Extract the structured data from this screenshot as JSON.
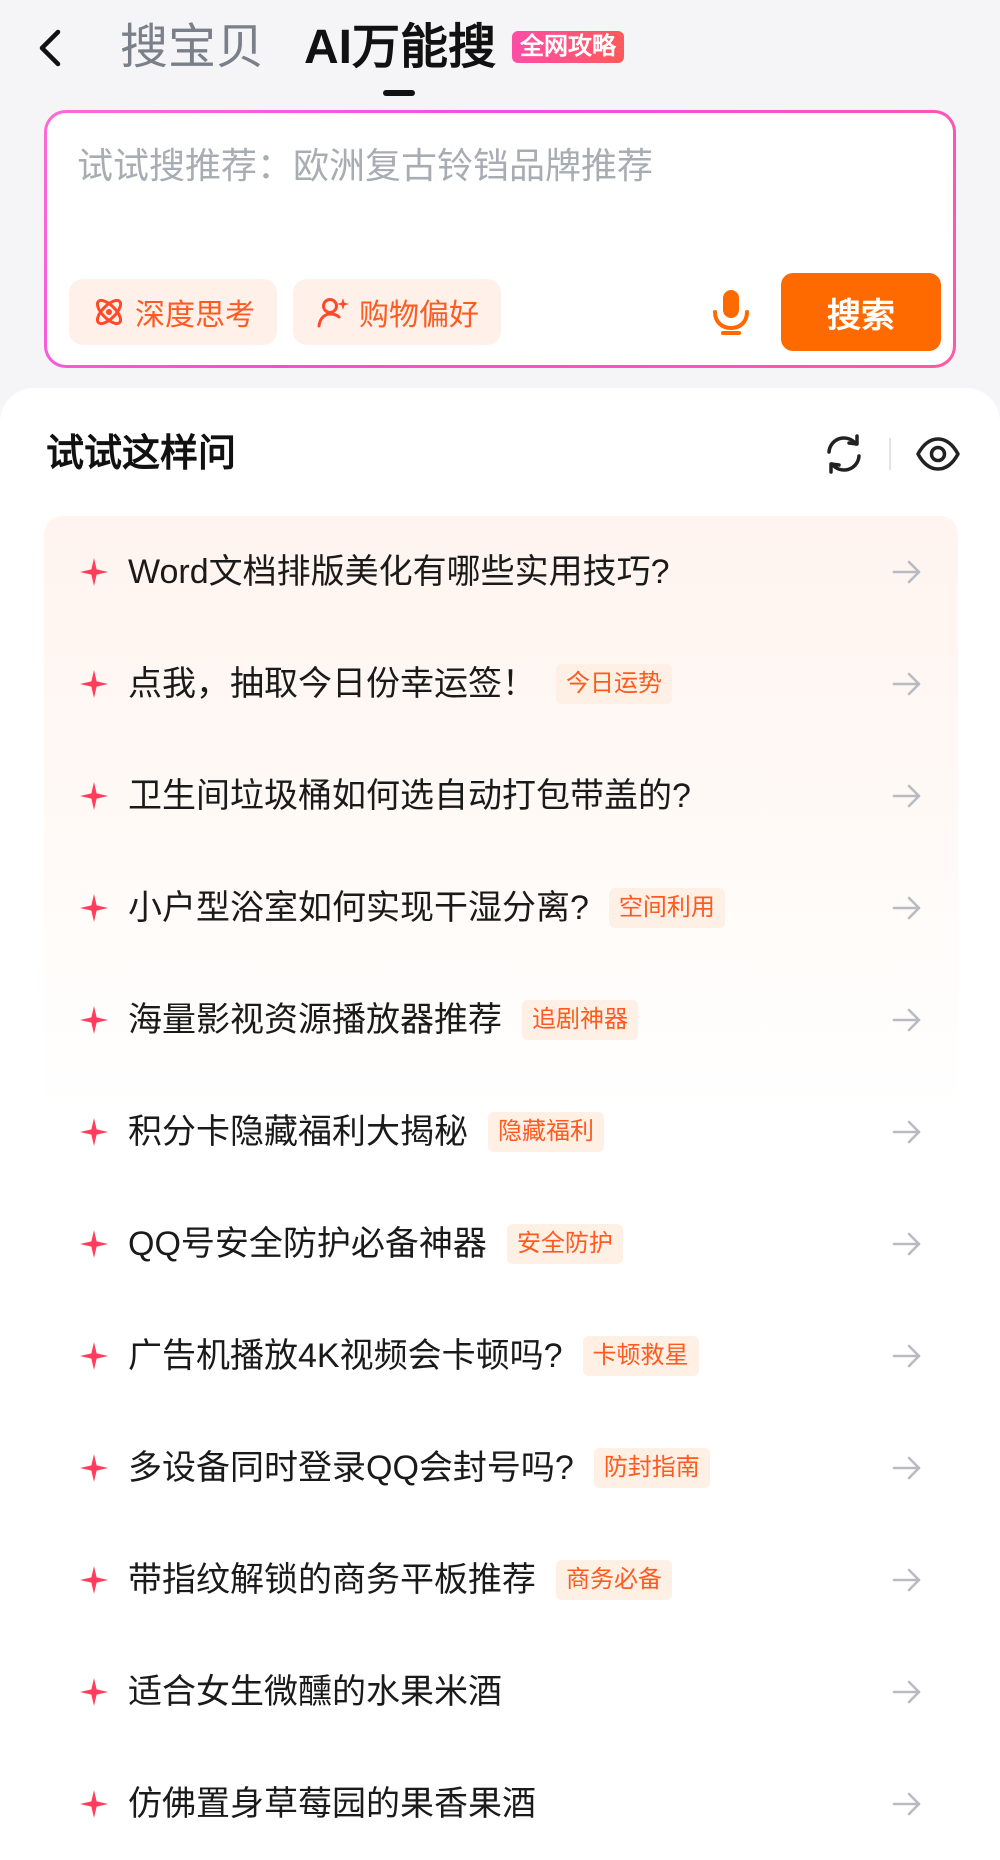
{
  "header": {
    "tab_goods": "搜宝贝",
    "tab_ai": "AI万能搜",
    "badge": "全网攻略"
  },
  "search": {
    "placeholder": "试试搜推荐：欧洲复古铃铛品牌推荐",
    "chip_deep": "深度思考",
    "chip_pref": "购物偏好",
    "button": "搜索"
  },
  "panel": {
    "title": "试试这样问",
    "items": [
      {
        "text": "Word文档排版美化有哪些实用技巧?",
        "tag": ""
      },
      {
        "text": "点我，抽取今日份幸运签！",
        "tag": "今日运势"
      },
      {
        "text": "卫生间垃圾桶如何选自动打包带盖的?",
        "tag": ""
      },
      {
        "text": "小户型浴室如何实现干湿分离?",
        "tag": "空间利用"
      },
      {
        "text": "海量影视资源播放器推荐",
        "tag": "追剧神器"
      },
      {
        "text": "积分卡隐藏福利大揭秘",
        "tag": "隐藏福利"
      },
      {
        "text": "QQ号安全防护必备神器",
        "tag": "安全防护"
      },
      {
        "text": "广告机播放4K视频会卡顿吗?",
        "tag": "卡顿救星"
      },
      {
        "text": "多设备同时登录QQ会封号吗?",
        "tag": "防封指南"
      },
      {
        "text": "带指纹解锁的商务平板推荐",
        "tag": "商务必备"
      },
      {
        "text": "适合女生微醺的水果米酒",
        "tag": ""
      },
      {
        "text": "仿佛置身草莓园的果香果酒",
        "tag": ""
      }
    ]
  },
  "colors": {
    "accent": "#ff6a00",
    "tag_text": "#ff5a1f",
    "tag_bg": "#fff0e6",
    "star": "#ff3d5a",
    "border_gradient_start": "#ff6ad5",
    "border_gradient_end": "#ff5aa0"
  },
  "icons": {
    "back": "chevron-left-icon",
    "deep": "atom-icon",
    "pref": "user-sparkle-icon",
    "mic": "microphone-icon",
    "refresh": "refresh-icon",
    "eye": "eye-icon",
    "star": "sparkle-star-icon",
    "arrow": "arrow-right-icon"
  }
}
